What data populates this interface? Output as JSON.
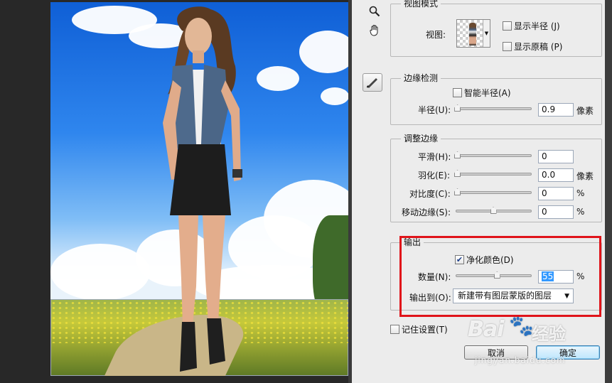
{
  "view_mode": {
    "title": "视图模式",
    "view_label": "视图:",
    "show_radius": "显示半径 (J)",
    "show_original": "显示原稿 (P)"
  },
  "edge_detection": {
    "title": "边缘检测",
    "smart_radius": "智能半径(A)",
    "radius_label": "半径(U):",
    "radius_value": "0.9",
    "radius_unit": "像素",
    "radius_level": 0.02
  },
  "adjust_edge": {
    "title": "调整边缘",
    "smooth_label": "平滑(H):",
    "smooth_value": "0",
    "feather_label": "羽化(E):",
    "feather_value": "0.0",
    "feather_unit": "像素",
    "contrast_label": "对比度(C):",
    "contrast_value": "0",
    "contrast_unit": "%",
    "shift_label": "移动边缘(S):",
    "shift_value": "0",
    "shift_unit": "%",
    "shift_level": 0.5
  },
  "output": {
    "title": "输出",
    "decontaminate": "净化颜色(D)",
    "decontaminate_checked": true,
    "amount_label": "数量(N):",
    "amount_value": "55",
    "amount_unit": "%",
    "amount_level": 0.55,
    "output_to_label": "输出到(O):",
    "output_to_value": "新建带有图层蒙版的图层"
  },
  "remember": "记住设置(T)",
  "buttons": {
    "cancel": "取消",
    "ok": "确定"
  },
  "watermark": {
    "main": "Bai",
    "paw": "🐾",
    "sub": "jingyan.baidu.com",
    "tail": "经验"
  },
  "colors": {
    "highlight": "#e0141a",
    "accent": "#3399ff"
  },
  "icons": {
    "zoom": "magnifier-icon",
    "hand": "hand-icon",
    "brush": "refine-radius-brush-icon"
  }
}
